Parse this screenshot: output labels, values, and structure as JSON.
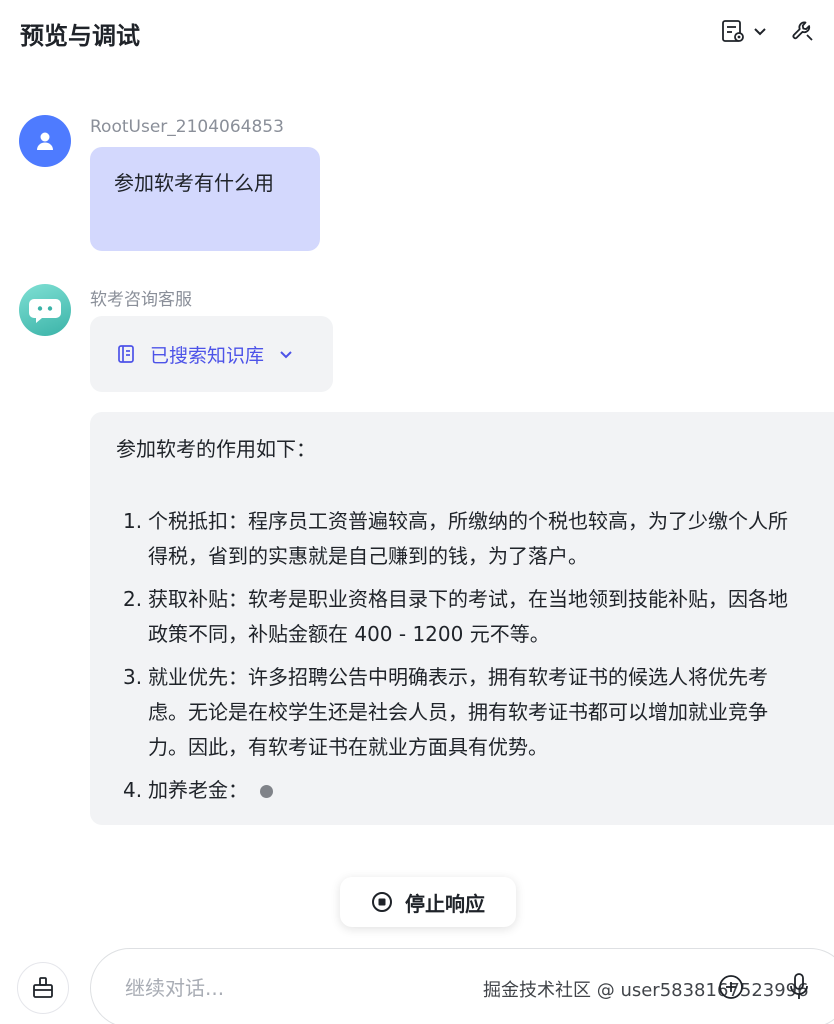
{
  "header": {
    "title": "预览与调试"
  },
  "messages": {
    "user": {
      "name": "RootUser_2104064853",
      "text": "参加软考有什么用"
    },
    "bot": {
      "name": "软考咨询客服",
      "kb_status": "已搜索知识库",
      "intro": "参加软考的作用如下：",
      "points": [
        {
          "num": "1.",
          "text": "个税抵扣：程序员工资普遍较高，所缴纳的个税也较高，为了少缴个人所得税，省到的实惠就是自己赚到的钱，为了落户。"
        },
        {
          "num": "2.",
          "text": "获取补贴：软考是职业资格目录下的考试，在当地领到技能补贴，因各地政策不同，补贴金额在 400 - 1200 元不等。"
        },
        {
          "num": "3.",
          "text": "就业优先：许多招聘公告中明确表示，拥有软考证书的候选人将优先考虑。无论是在校学生还是社会人员，拥有软考证书都可以增加就业竞争力。因此，有软考证书在就业方面具有优势。"
        },
        {
          "num": "4.",
          "text": "加养老金："
        }
      ]
    }
  },
  "controls": {
    "stop_label": "停止响应",
    "input_placeholder": "继续对话..."
  },
  "watermark": "掘金技术社区 @ user5838167523996",
  "colors": {
    "accent": "#4d53e8",
    "user_bubble": "#d3d8fd",
    "bot_bubble": "#f2f3f5",
    "user_avatar": "#4e7bff",
    "bot_avatar": "#3bb3a8"
  }
}
